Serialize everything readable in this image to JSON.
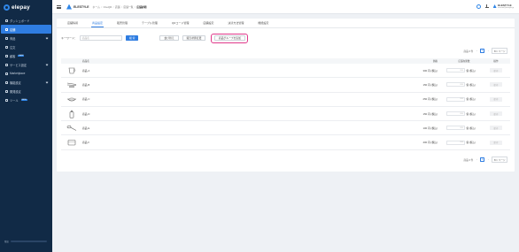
{
  "app": {
    "logo_text": "elepay"
  },
  "sidebar": {
    "items": [
      {
        "label": "ダッシュボード",
        "icon": "dashboard-icon"
      },
      {
        "label": "店舗",
        "icon": "store-icon",
        "active": true
      },
      {
        "label": "商品",
        "icon": "product-icon",
        "chevron": true
      },
      {
        "label": "注文",
        "icon": "order-icon"
      },
      {
        "label": "顧客",
        "icon": "customer-icon",
        "badge": "NEW"
      },
      {
        "label": "サービス設定",
        "icon": "service-icon",
        "chevron": true
      },
      {
        "label": "Marketplace",
        "icon": "marketplace-icon"
      },
      {
        "label": "機能設定",
        "icon": "feature-icon",
        "chevron": true
      },
      {
        "label": "開発設定",
        "icon": "dev-icon"
      },
      {
        "label": "ツール",
        "icon": "tool-icon",
        "badge": "NEW"
      }
    ],
    "footer_label": "残高"
  },
  "topbar": {
    "store_name": "ELESTYLE",
    "breadcrumbs": [
      "ホーム",
      "OneQR",
      "店舗",
      "店舗一覧",
      "店舗詳細"
    ],
    "user_name": "ELESTYLE",
    "user_sub": "account@elestyle.jp"
  },
  "tabs": [
    {
      "label": "店舗情報"
    },
    {
      "label": "商品設定",
      "active": true
    },
    {
      "label": "販売管理"
    },
    {
      "label": "テーブル管理"
    },
    {
      "label": "QRコード管理"
    },
    {
      "label": "店舗設定"
    },
    {
      "label": "決済方法管理"
    },
    {
      "label": "機能設定"
    }
  ],
  "filter": {
    "keyword_label": "キーワード：",
    "keyword_placeholder": "商品名",
    "search_label": "検 索",
    "set_button": "並び替え",
    "bulk_button": "販売状態変更",
    "group_button": "商品グループを追加"
  },
  "pager": {
    "total": "商品 6 件",
    "page": "1",
    "page_size": "50 / ページ"
  },
  "table": {
    "headers": {
      "name": "商品名",
      "price": "価格",
      "stock": "店舗在庫数",
      "op": "操作"
    },
    "rows": [
      {
        "name": "商品 A",
        "price": "300 円 (税込)",
        "icon": "cup-icon"
      },
      {
        "name": "商品 B",
        "price": "150 円 (税込)",
        "icon": "chopsticks-icon"
      },
      {
        "name": "商品 C",
        "price": "250 円 (税込)",
        "icon": "bowl-icon"
      },
      {
        "name": "商品 D",
        "price": "150 円 (税込)",
        "icon": "bottle-icon"
      },
      {
        "name": "商品 E",
        "price": "100 円 (税込)",
        "icon": "spoon-icon"
      },
      {
        "name": "商品 F",
        "price": "400 円 (税込)",
        "icon": "bento-icon"
      }
    ],
    "stock_placeholder": "999",
    "stock_unit": "個 (税込)",
    "save_label": "保 存"
  },
  "colors": {
    "accent": "#2f7de1",
    "sidebar": "#112a46",
    "highlight": "#e0388a"
  }
}
